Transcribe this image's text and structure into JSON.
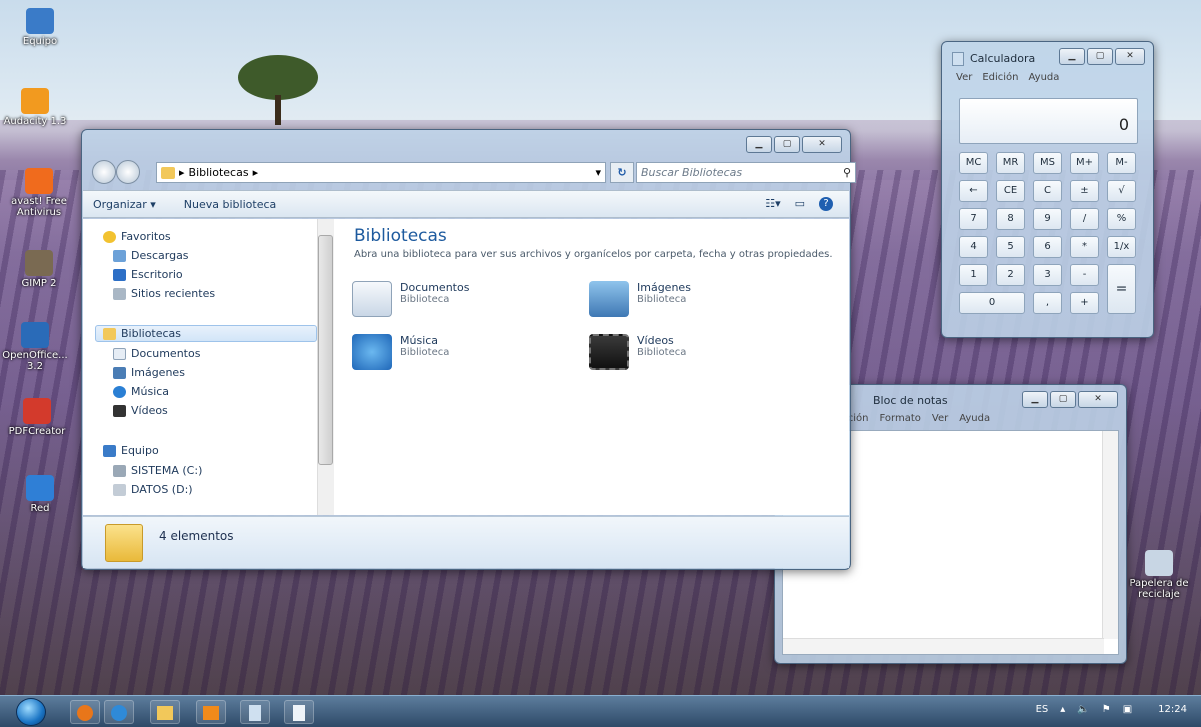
{
  "desktop_icons": [
    {
      "name": "desktop-icon-equipo",
      "label": "Equipo",
      "color": "#3a7bc8"
    },
    {
      "name": "desktop-icon-audacity",
      "label": "Audacity 1.3",
      "color": "#f29a1f"
    },
    {
      "name": "desktop-icon-avast",
      "label": "avast! Free Antivirus",
      "color": "#f06b1d"
    },
    {
      "name": "desktop-icon-gimp",
      "label": "GIMP 2",
      "color": "#7a6a52"
    },
    {
      "name": "desktop-icon-openoffice",
      "label": "OpenOffice... 3.2",
      "color": "#2a6bb8"
    },
    {
      "name": "desktop-icon-pdfcreator",
      "label": "PDFCreator",
      "color": "#d33a2c"
    },
    {
      "name": "desktop-icon-red",
      "label": "Red",
      "color": "#2f7fd6"
    },
    {
      "name": "desktop-icon-papelera",
      "label": "Papelera de reciclaje",
      "color": "#c8d6e4"
    }
  ],
  "explorer": {
    "path": "Bibliotecas",
    "search_placeholder": "Buscar Bibliotecas",
    "toolbar": {
      "organize": "Organizar ▾",
      "new_library": "Nueva biblioteca"
    },
    "nav": {
      "favorites": "Favoritos",
      "downloads": "Descargas",
      "desktop": "Escritorio",
      "recent": "Sitios recientes",
      "libraries": "Bibliotecas",
      "documents": "Documentos",
      "images": "Imágenes",
      "music": "Música",
      "videos": "Vídeos",
      "computer": "Equipo",
      "drive_c": "SISTEMA (C:)",
      "drive_d": "DATOS (D:)"
    },
    "content": {
      "title": "Bibliotecas",
      "description": "Abra una biblioteca para ver sus archivos y organícelos por carpeta, fecha y otras propiedades.",
      "libraries": [
        {
          "name": "Documentos",
          "type": "Biblioteca"
        },
        {
          "name": "Imágenes",
          "type": "Biblioteca"
        },
        {
          "name": "Música",
          "type": "Biblioteca"
        },
        {
          "name": "Vídeos",
          "type": "Biblioteca"
        }
      ]
    },
    "status": "4 elementos"
  },
  "calculator": {
    "title": "Calculadora",
    "menu": [
      "Ver",
      "Edición",
      "Ayuda"
    ],
    "display": "0",
    "keys": [
      "MC",
      "MR",
      "MS",
      "M+",
      "M-",
      "←",
      "CE",
      "C",
      "±",
      "√",
      "7",
      "8",
      "9",
      "/",
      "%",
      "4",
      "5",
      "6",
      "*",
      "1/x",
      "1",
      "2",
      "3",
      "-",
      "=",
      "0",
      ",",
      "+"
    ]
  },
  "notepad": {
    "title": "Bloc de notas",
    "menu": [
      "ición",
      "Formato",
      "Ver",
      "Ayuda"
    ]
  },
  "taskbar": {
    "lang": "ES",
    "clock": "12:24"
  }
}
